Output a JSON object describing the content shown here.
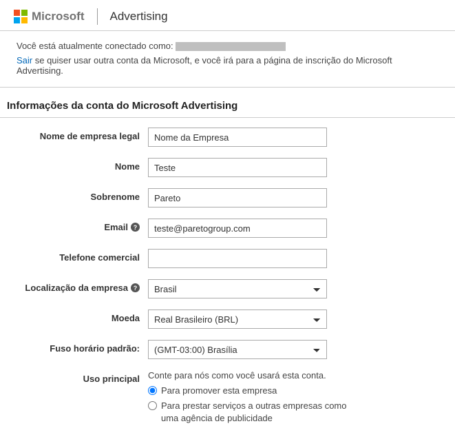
{
  "header": {
    "brand": "Microsoft",
    "product": "Advertising"
  },
  "status": {
    "connected_prefix": "Você está atualmente conectado como:",
    "sign_out": "Sair",
    "switch_account_text": " se quiser usar outra conta da Microsoft, e você irá para a página de inscrição do Microsoft Advertising."
  },
  "section": {
    "title": "Informações da conta do Microsoft Advertising"
  },
  "form": {
    "company_name": {
      "label": "Nome de empresa legal",
      "value": "Nome da Empresa"
    },
    "first_name": {
      "label": "Nome",
      "value": "Teste"
    },
    "last_name": {
      "label": "Sobrenome",
      "value": "Pareto"
    },
    "email": {
      "label": "Email",
      "value": "teste@paretogroup.com"
    },
    "phone": {
      "label": "Telefone comercial",
      "value": ""
    },
    "location": {
      "label": "Localização da empresa",
      "value": "Brasil"
    },
    "currency": {
      "label": "Moeda",
      "value": "Real Brasileiro (BRL)"
    },
    "timezone": {
      "label": "Fuso horário padrão:",
      "value": "(GMT-03:00) Brasília"
    },
    "usage": {
      "label": "Uso principal",
      "hint": "Conte para nós como você usará esta conta.",
      "option_promote": "Para promover esta empresa",
      "option_agency": "Para prestar serviços a outras empresas como uma agência de publicidade"
    },
    "help_glyph": "?"
  }
}
